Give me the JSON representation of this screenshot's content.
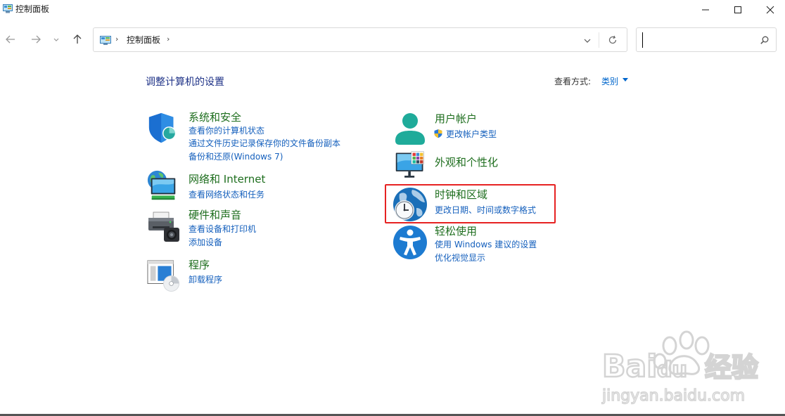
{
  "window": {
    "title": "控制面板"
  },
  "address": {
    "separator": "›",
    "path_label": "控制面板",
    "trail_separator": "›"
  },
  "search": {
    "placeholder": "",
    "value": ""
  },
  "content": {
    "page_title": "调整计算机的设置",
    "view_by_label": "查看方式:",
    "view_by_value": "类别"
  },
  "categories": [
    {
      "title": "系统和安全",
      "links": [
        "查看你的计算机状态",
        "通过文件历史记录保存你的文件备份副本",
        "备份和还原(Windows 7)"
      ]
    },
    {
      "title": "网络和 Internet",
      "links": [
        "查看网络状态和任务"
      ]
    },
    {
      "title": "硬件和声音",
      "links": [
        "查看设备和打印机",
        "添加设备"
      ]
    },
    {
      "title": "程序",
      "links": [
        "卸载程序"
      ]
    },
    {
      "title": "用户帐户",
      "links": [
        "更改帐户类型"
      ]
    },
    {
      "title": "外观和个性化",
      "links": []
    },
    {
      "title": "时钟和区域",
      "links": [
        "更改日期、时间或数字格式"
      ]
    },
    {
      "title": "轻松使用",
      "links": [
        "使用 Windows 建议的设置",
        "优化视觉显示"
      ]
    }
  ],
  "colors": {
    "title_blue": "#1e3287",
    "category_green": "#1e6e1e",
    "link_blue": "#1560bd",
    "highlight_red": "#e62222"
  },
  "icons": {
    "system_security": "shield-icon",
    "network": "globe-monitor-icon",
    "hardware": "printer-icon",
    "programs": "program-disc-icon",
    "user_accounts": "user-icon",
    "uac": "uac-shield-icon",
    "appearance": "monitor-palette-icon",
    "clock_region": "clock-globe-icon",
    "ease_of_access": "accessibility-icon"
  }
}
